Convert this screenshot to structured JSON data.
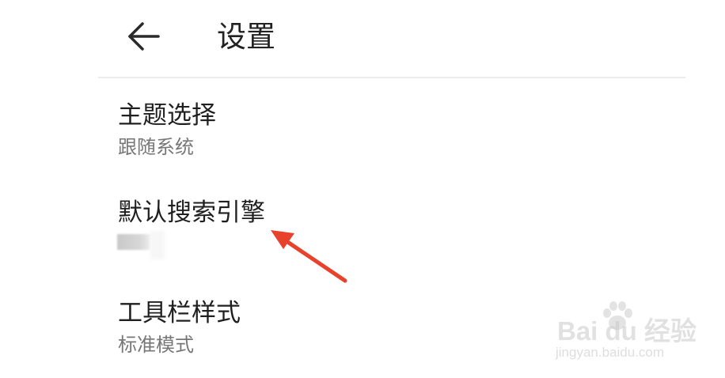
{
  "header": {
    "title": "设置",
    "back_icon": "arrow-left-icon"
  },
  "settings": {
    "theme": {
      "title": "主题选择",
      "value": "跟随系统"
    },
    "search_engine": {
      "title": "默认搜索引擎",
      "value_redacted": true
    },
    "toolbar": {
      "title": "工具栏样式",
      "value": "标准模式"
    }
  },
  "annotation": {
    "color": "#e8412c"
  },
  "watermark": {
    "logo_text": "Bai  du 经验",
    "url_text": "jingyan.baidu.com"
  },
  "colors": {
    "background": "#ffffff",
    "title_text": "#222222",
    "value_text": "#777777",
    "divider": "#ececec"
  }
}
